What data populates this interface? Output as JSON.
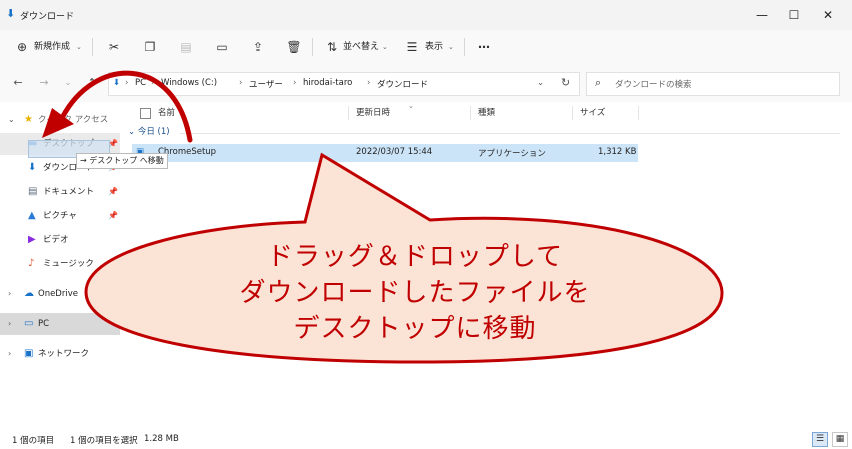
{
  "window": {
    "title": "ダウンロード"
  },
  "toolbar": {
    "new_label": "新規作成",
    "sort_label": "並べ替え",
    "view_label": "表示"
  },
  "address": {
    "crumbs": [
      "PC",
      "Windows (C:)",
      "ユーザー",
      "hirodai-taro",
      "ダウンロード"
    ],
    "search_placeholder": "ダウンロードの検索"
  },
  "sidebar": {
    "items": [
      {
        "label": "クイック アクセス"
      },
      {
        "label": "デスクトップ"
      },
      {
        "label": "ダウンロード"
      },
      {
        "label": "ドキュメント"
      },
      {
        "label": "ピクチャ"
      },
      {
        "label": "ビデオ"
      },
      {
        "label": "ミュージック"
      },
      {
        "label": "OneDrive"
      },
      {
        "label": "PC"
      },
      {
        "label": "ネットワーク"
      }
    ]
  },
  "columns": {
    "name": "名前",
    "date": "更新日時",
    "type": "種類",
    "size": "サイズ"
  },
  "group": {
    "label": "今日 (1)"
  },
  "files": [
    {
      "name": "ChromeSetup",
      "date": "2022/03/07 15:44",
      "type": "アプリケーション",
      "size": "1,312 KB"
    }
  ],
  "drag": {
    "tooltip": "→ デスクトップ へ移動"
  },
  "callout": {
    "line1": "ドラッグ＆ドロップして",
    "line2": "ダウンロードしたファイルを",
    "line3": "デスクトップに移動"
  },
  "status": {
    "count": "1 個の項目",
    "selected": "1 個の項目を選択",
    "size": "1.28 MB"
  },
  "colors": {
    "accent": "#c00000",
    "callout_fill": "#fbe3d6",
    "selection": "#cce4f7"
  }
}
